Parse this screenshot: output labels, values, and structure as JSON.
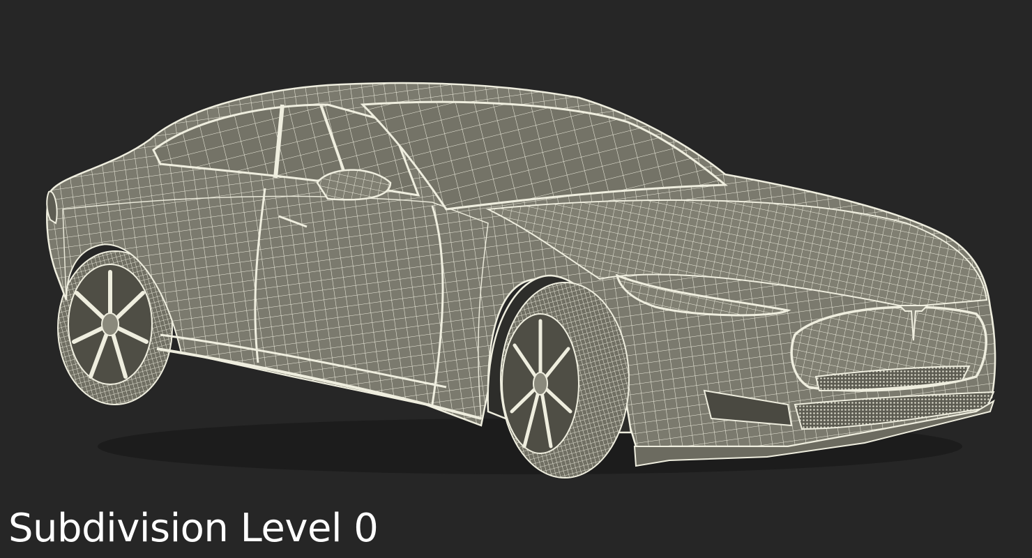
{
  "caption": {
    "text": "Subdivision Level 0"
  },
  "render": {
    "subject": "car-wireframe-model",
    "background_color": "#262626",
    "body_color": "#7b7a6e",
    "wire_color": "#eeeee0",
    "caption_color": "#ffffff"
  }
}
